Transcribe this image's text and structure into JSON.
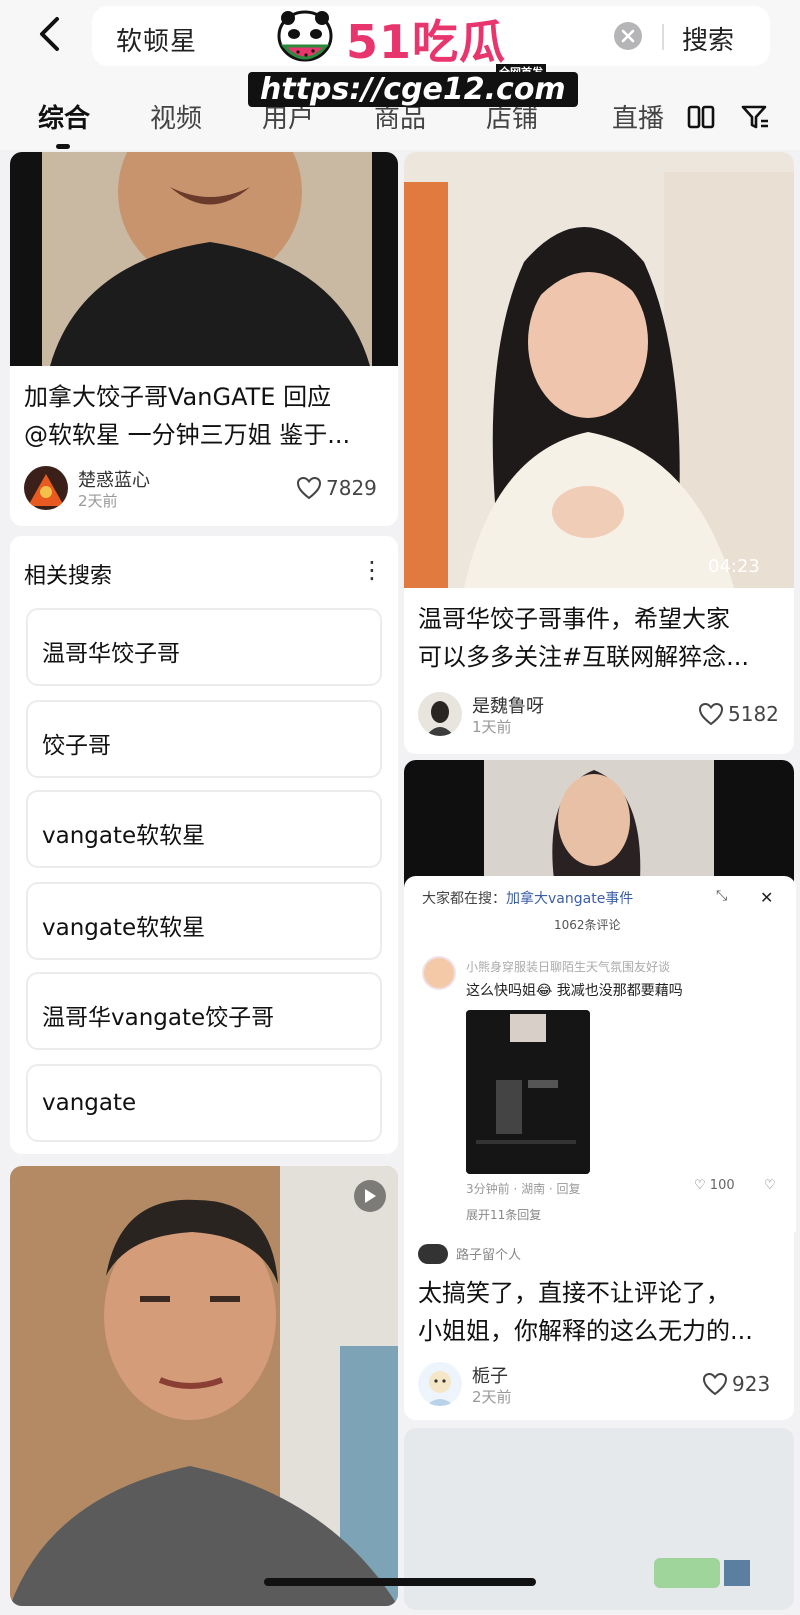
{
  "search": {
    "query": "软顿星",
    "button": "搜索"
  },
  "watermark": {
    "brand": "51吃瓜",
    "tag": "全网首发",
    "url": "https://cge12.com"
  },
  "tabs": [
    {
      "label": "综合",
      "active": true
    },
    {
      "label": "视频",
      "active": false
    },
    {
      "label": "用户",
      "active": false
    },
    {
      "label": "商品",
      "active": false
    },
    {
      "label": "店铺",
      "active": false
    },
    {
      "label": "直播",
      "active": false
    }
  ],
  "cards": {
    "card1": {
      "title_line1": "加拿大饺子哥VanGATE 回应",
      "title_line2": "@软软星 一分钟三万姐 鉴于...",
      "author": "楚惑蓝心",
      "time": "2天前",
      "likes": "7829"
    },
    "card2": {
      "duration": "04:23",
      "title_line1": "温哥华饺子哥事件，希望大家",
      "title_line2": "可以多多关注#互联网解猝念...",
      "author": "是魏鲁呀",
      "time": "1天前",
      "likes": "5182"
    },
    "card3": {
      "popup_head_prefix": "大家都在搜：",
      "popup_head_link": "加拿大vangate事件",
      "popup_sub": "1062条评论",
      "comment_user": "小熊身穿服装日聊陌生天气氛围友好谈",
      "comment_text": "这么快吗姐😂 我减也没那都要藉吗",
      "comment_meta": "3分钟前 · 湖南 · 回复",
      "comment_likes": "100",
      "comment_expand": "展开11条回复",
      "reply_user": "路子留个人",
      "title_line1": "太搞笑了，直接不让评论了，",
      "title_line2": "小姐姐，你解释的这么无力的...",
      "author": "栀子",
      "time": "2天前",
      "likes": "923"
    }
  },
  "related": {
    "title": "相关搜索",
    "items": [
      "温哥华饺子哥",
      "饺子哥",
      "vangate软软星",
      "vangate软软星",
      "温哥华vangate饺子哥",
      "vangate"
    ]
  },
  "colors": {
    "accent": "#e8356d",
    "background": "#f2f2f4"
  }
}
